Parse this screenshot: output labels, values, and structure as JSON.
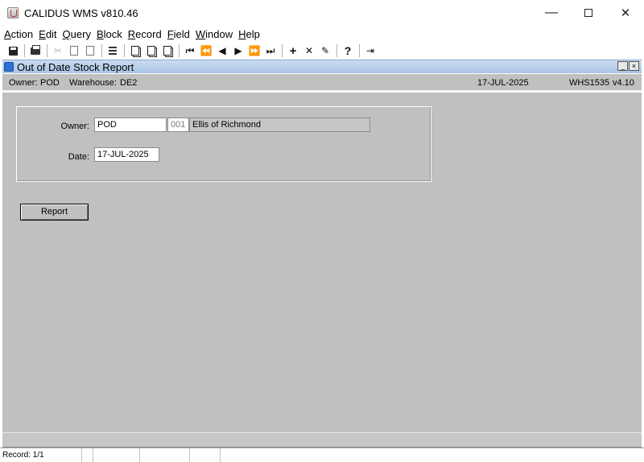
{
  "window": {
    "title": "CALIDUS WMS v810.46",
    "minimize_glyph": "—",
    "close_glyph": "✕"
  },
  "menu": [
    {
      "mnemonic": "A",
      "rest": "ction"
    },
    {
      "mnemonic": "E",
      "rest": "dit"
    },
    {
      "mnemonic": "Q",
      "rest": "uery"
    },
    {
      "mnemonic": "B",
      "rest": "lock"
    },
    {
      "mnemonic": "R",
      "rest": "ecord"
    },
    {
      "mnemonic": "F",
      "rest": "ield"
    },
    {
      "mnemonic": "W",
      "rest": "indow"
    },
    {
      "mnemonic": "H",
      "rest": "elp"
    }
  ],
  "toolbar": {
    "glyphs": {
      "cut": "✂",
      "first": "⏮",
      "prev_block": "⏪",
      "prev": "◀",
      "next": "▶",
      "next_block": "⏩",
      "last": "⏭",
      "insert": "+",
      "delete": "✕",
      "edit": "✎",
      "help": "?",
      "exit": "⇥"
    }
  },
  "form_window": {
    "title": "Out of Date Stock Report",
    "min_glyph": "_",
    "close_glyph": "×"
  },
  "info_bar": {
    "owner_label": "Owner:",
    "owner_value": "POD",
    "warehouse_label": "Warehouse:",
    "warehouse_value": "DE2",
    "date": "17-JUL-2025",
    "form_code": "WHS1535",
    "version": "v4.10"
  },
  "form": {
    "owner_label": "Owner:",
    "owner_value": "POD",
    "owner_code": "001",
    "owner_name": "Ellis of Richmond",
    "date_label": "Date:",
    "date_value": "17-JUL-2025",
    "report_button": "Report"
  },
  "status_bar": {
    "record": "Record: 1/1"
  }
}
